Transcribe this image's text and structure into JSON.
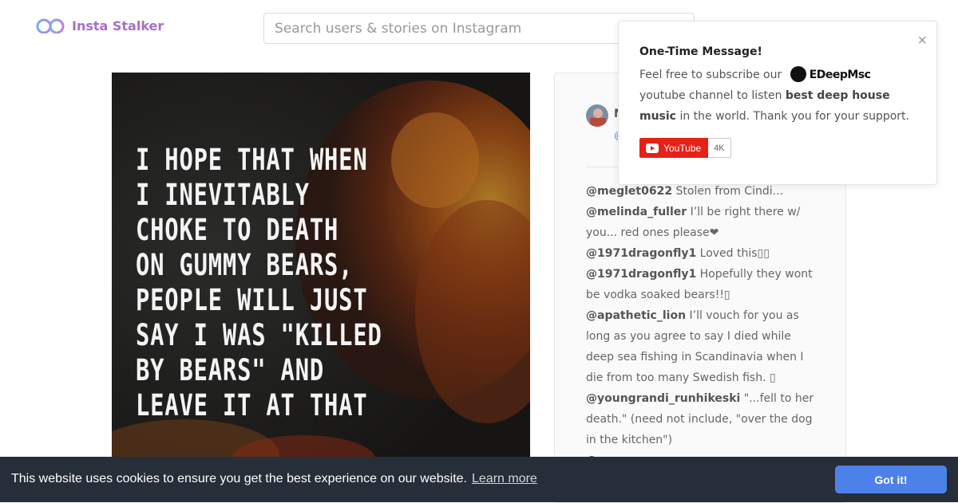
{
  "header": {
    "logo_text": "Insta Stalker",
    "search_placeholder": "Search users & stories on Instagram"
  },
  "post": {
    "quote_lines": [
      "I HOPE THAT WHEN",
      "I INEVITABLY",
      "CHOKE TO DEATH",
      "ON GUMMY BEARS,",
      "PEOPLE WILL JUST",
      "SAY I WAS \"KILLED",
      "BY BEARS\" AND",
      "LEAVE IT AT THAT"
    ],
    "author_initial": "M",
    "author_at": "@"
  },
  "comments": [
    {
      "user": "@meglet0622",
      "text": " Stolen from Cindi..."
    },
    {
      "user": "@melinda_fuller",
      "text": " I’ll be right there w/ you... red ones please❤"
    },
    {
      "user": "@1971dragonfly1",
      "text": " Loved this▯▯"
    },
    {
      "user": "@1971dragonfly1",
      "text": " Hopefully they wont be vodka soaked bears!!▯"
    },
    {
      "user": "@apathetic_lion",
      "text": " I’ll vouch for you as long as you agree to say I died while deep sea fishing in Scandinavia when I die from too many Swedish fish. ▯"
    },
    {
      "user": "@youngrandi_runhikeski",
      "text": " \"...fell to her death.\" (need not include, \"over the dog in the kitchen\")"
    },
    {
      "user": "@...",
      "text": ""
    }
  ],
  "popup": {
    "close": "×",
    "title": "One-Time Message!",
    "line_start": "Feel free to subscribe our ",
    "channel": "EDeepMsc",
    "line_mid": " youtube channel to listen ",
    "highlight": "best deep house music",
    "line_end": " in the world. Thank you for your support.",
    "yt_label": "YouTube",
    "yt_count": "4K"
  },
  "cookie": {
    "message": "This website uses cookies to ensure you get the best experience on our website.",
    "link": "Learn more",
    "button": "Got it!"
  }
}
